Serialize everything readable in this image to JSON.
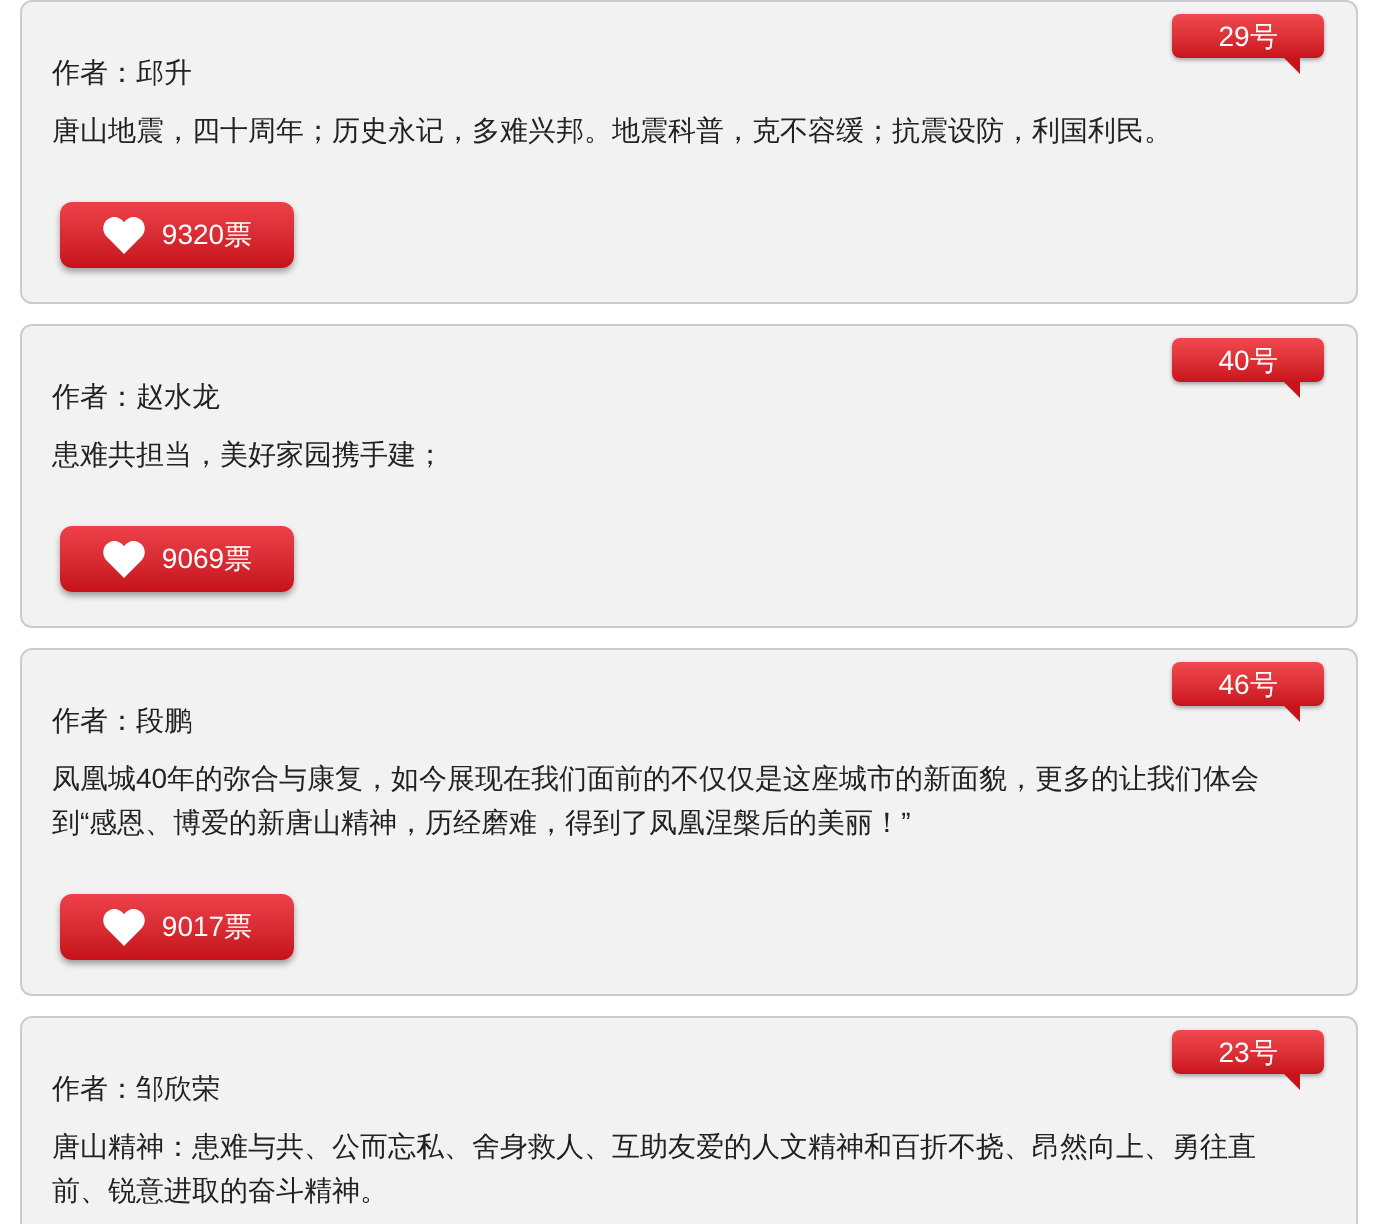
{
  "entries": [
    {
      "number": "29号",
      "author": "作者：邱升",
      "text": "唐山地震，四十周年；历史永记，多难兴邦。地震科普，克不容缓；抗震设防，利国利民。",
      "votes": "9320票"
    },
    {
      "number": "40号",
      "author": "作者：赵水龙",
      "text": "患难共担当，美好家园携手建；",
      "votes": "9069票"
    },
    {
      "number": "46号",
      "author": "作者：段鹏",
      "text": "凤凰城40年的弥合与康复，如今展现在我们面前的不仅仅是这座城市的新面貌，更多的让我们体会到“感恩、博爱的新唐山精神，历经磨难，得到了凤凰涅槃后的美丽！”",
      "votes": "9017票"
    },
    {
      "number": "23号",
      "author": "作者：邹欣荣",
      "text": "唐山精神：患难与共、公而忘私、舍身救人、互助友爱的人文精神和百折不挠、昂然向上、勇往直前、锐意进取的奋斗精神。"
    }
  ]
}
